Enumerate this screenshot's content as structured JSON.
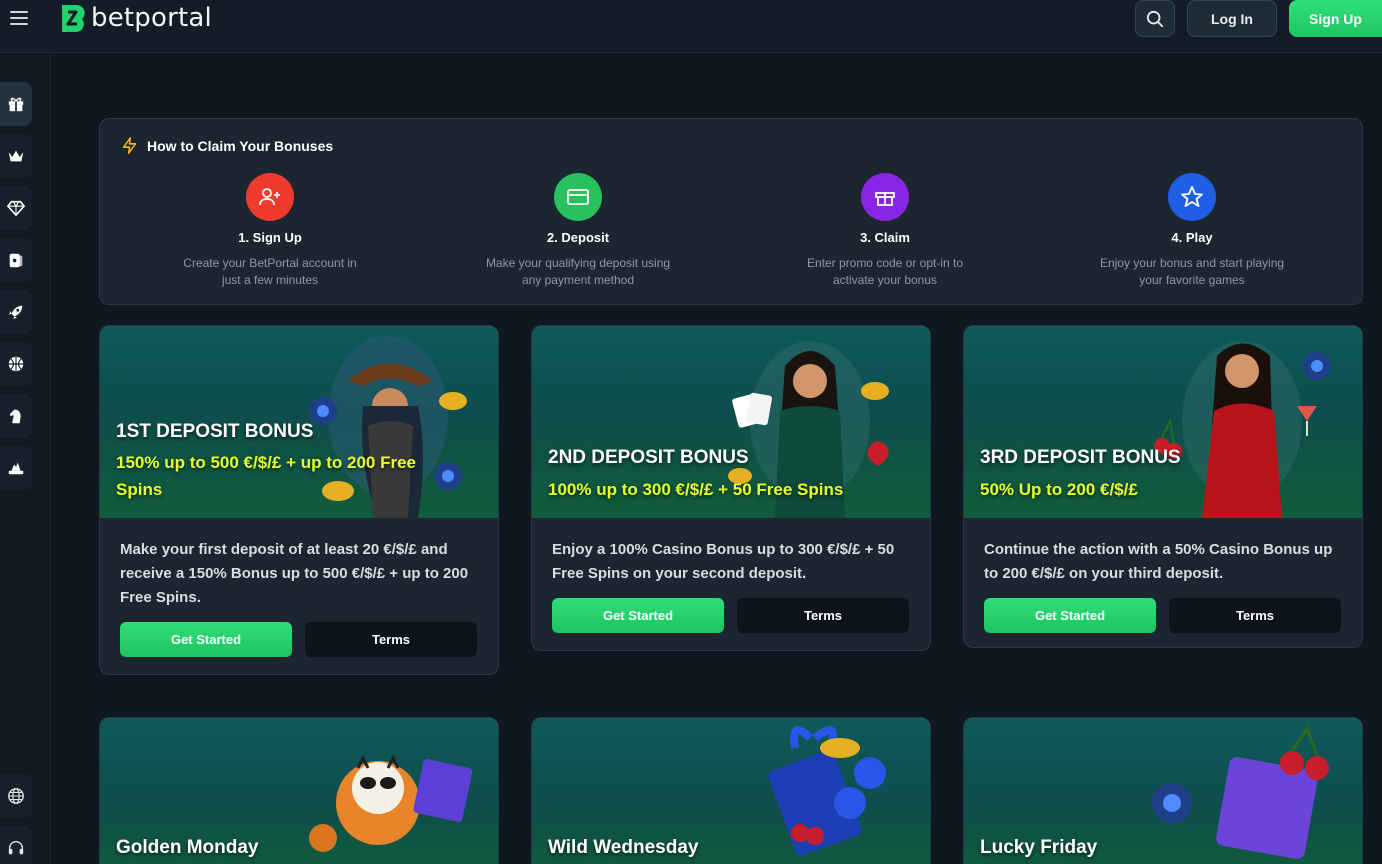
{
  "header": {
    "brand": "betportal",
    "login_label": "Log In",
    "signup_label": "Sign Up"
  },
  "sidebar": {
    "items": [
      {
        "icon": "gift-icon"
      },
      {
        "icon": "crown-icon"
      },
      {
        "icon": "diamond-icon"
      },
      {
        "icon": "cards-icon"
      },
      {
        "icon": "rocket-icon"
      },
      {
        "icon": "sports-ball-icon"
      },
      {
        "icon": "horse-head-icon"
      },
      {
        "icon": "poker-icon"
      }
    ],
    "bottom_items": [
      {
        "icon": "globe-icon"
      },
      {
        "icon": "headset-icon"
      }
    ]
  },
  "how_to": {
    "title": "How to Claim Your Bonuses",
    "steps": [
      {
        "title": "1. Sign Up",
        "desc_line1": "Create your BetPortal account in",
        "desc_line2": "just a few minutes",
        "color": "#ef3b2d",
        "icon": "user-plus-icon"
      },
      {
        "title": "2. Deposit",
        "desc_line1": "Make your qualifying deposit using",
        "desc_line2": "any payment method",
        "color": "#27c25e",
        "icon": "credit-card-icon"
      },
      {
        "title": "3. Claim",
        "desc_line1": "Enter promo code or opt-in to",
        "desc_line2": "activate your bonus",
        "color": "#8a25e6",
        "icon": "gift-icon"
      },
      {
        "title": "4. Play",
        "desc_line1": "Enjoy your bonus and start playing",
        "desc_line2": "your favorite games",
        "color": "#1f5fe6",
        "icon": "star-icon"
      }
    ]
  },
  "bonuses": [
    {
      "title": "1ST DEPOSIT BONUS",
      "offer_line1": "150% up to 500 €/$/£ + up to 200 Free",
      "offer_line2": "Spins",
      "description": "Make your first deposit of at least 20 €/$/£ and receive a 150% Bonus up to 500 €/$/£ + up to 200 Free Spins.",
      "start_label": "Get Started",
      "terms_label": "Terms"
    },
    {
      "title": "2ND DEPOSIT BONUS",
      "offer_line1": "100% up to 300 €/$/£ + 50 Free Spins",
      "description": "Enjoy a 100% Casino Bonus up to 300 €/$/£ + 50 Free Spins on your second deposit.",
      "start_label": "Get Started",
      "terms_label": "Terms"
    },
    {
      "title": "3RD DEPOSIT BONUS",
      "offer_line1": "50% Up to 200 €/$/£",
      "description": "Continue the action with a 50% Casino Bonus up to 200 €/$/£ on your third deposit.",
      "start_label": "Get Started",
      "terms_label": "Terms"
    }
  ],
  "promos": [
    {
      "title": "Golden Monday"
    },
    {
      "title": "Wild Wednesday"
    },
    {
      "title": "Lucky Friday"
    }
  ]
}
